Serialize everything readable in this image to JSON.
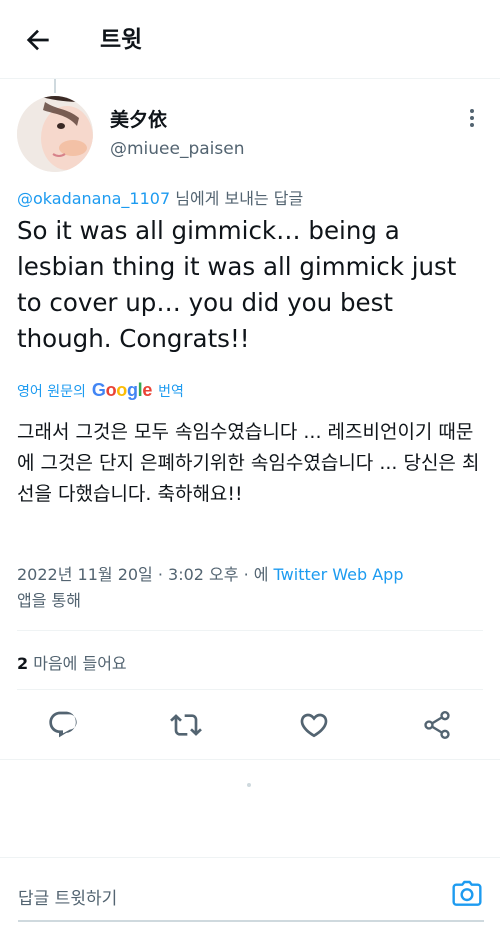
{
  "header": {
    "title": "트윗"
  },
  "tweet": {
    "author_name": "美夕依",
    "author_handle": "@miuee_paisen",
    "reply_mention": "@okadanana_1107",
    "reply_suffix": " 님에게 보내는 답글",
    "text": "So it was all gimmick… being a lesbian thing it was all gimmick just to cover up… you did you best though. Congrats!!",
    "translate_prefix": "영어 원문의",
    "translate_brand": "Google",
    "translate_suffix": "번역",
    "translated_text": "그래서 그것은 모두 속임수였습니다 ... 레즈비언이기 때문에 그것은 단지 은폐하기위한 속임수였습니다 ... 당신은 최선을 다했습니다. 축하해요!!",
    "timestamp": "2022년 11월 20일 · 3:02 오후 · 에 ",
    "via": "Twitter Web App",
    "via_suffix": "앱을 통해",
    "like_count": "2",
    "like_label": " 마음에 들어요"
  },
  "actions": {
    "reply_icon": "reply-icon",
    "retweet_icon": "retweet-icon",
    "like_icon": "heart-icon",
    "share_icon": "share-icon"
  },
  "composer": {
    "placeholder": "답글 트윗하기"
  },
  "colors": {
    "accent": "#1d9bf0",
    "secondary_text": "#536471",
    "primary_text": "#0f1419"
  }
}
